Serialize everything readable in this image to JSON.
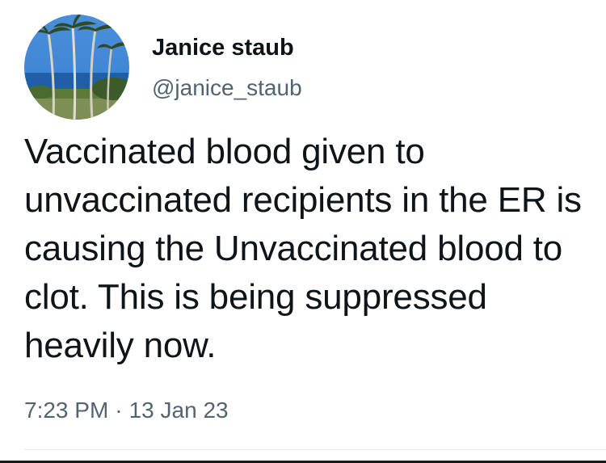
{
  "author": {
    "display_name": "Janice staub",
    "handle": "@janice_staub",
    "avatar_icon": "palm-beach-avatar"
  },
  "tweet": {
    "text": "Vaccinated blood given to unvaccinated recipients in the ER is causing the Unvaccinated blood to clot. This is being suppressed heavily now.",
    "time": "7:23 PM",
    "separator": "·",
    "date": "13 Jan 23"
  },
  "colors": {
    "text_primary": "#0f1419",
    "text_secondary": "#536471",
    "divider": "#e6ecf0"
  }
}
